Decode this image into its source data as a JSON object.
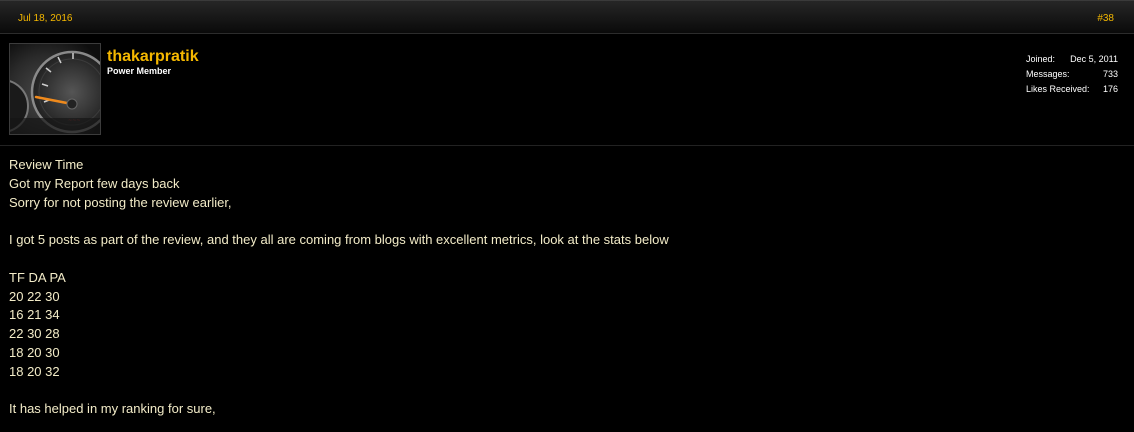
{
  "post": {
    "date": "Jul 18, 2016",
    "number": "#38"
  },
  "user": {
    "name": "thakarpratik",
    "title": "Power Member",
    "stats": [
      {
        "label": "Joined:",
        "value": "Dec 5, 2011"
      },
      {
        "label": "Messages:",
        "value": "733"
      },
      {
        "label": "Likes Received:",
        "value": "176"
      }
    ]
  },
  "message": {
    "lines": [
      "Review Time",
      "Got my Report few days back",
      "Sorry for not posting the review earlier,",
      "",
      "I got 5 posts as part of the review, and they all are coming from blogs with excellent metrics, look at the stats below",
      "",
      "TF DA PA",
      "20 22 30",
      "16 21 34",
      "22 30 28",
      "18 20 30",
      "18 20 32",
      "",
      "It has helped in my ranking for sure,"
    ]
  },
  "colors": {
    "accent": "#f5b800",
    "body_text": "#f3ecc8",
    "background": "#000000"
  }
}
